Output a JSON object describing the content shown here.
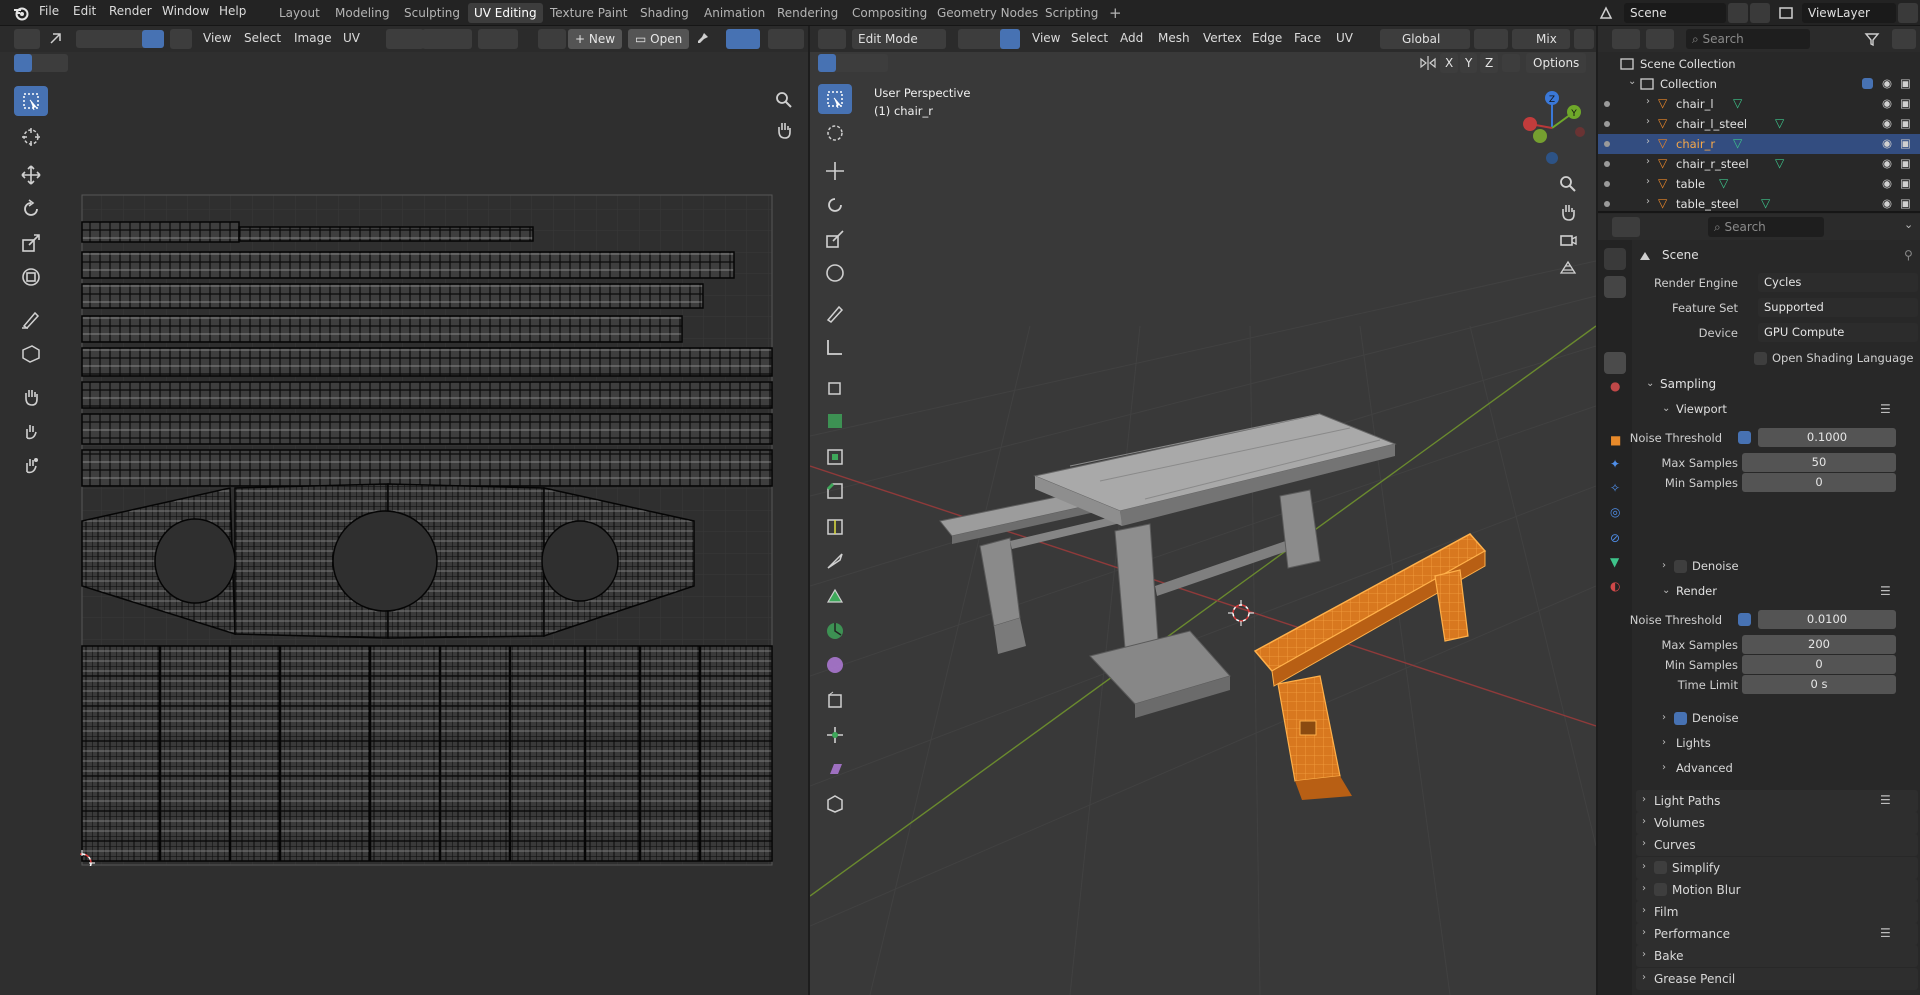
{
  "menu": {
    "items": [
      "File",
      "Edit",
      "Render",
      "Window",
      "Help"
    ],
    "workspaces": [
      "Layout",
      "Modeling",
      "Sculpting",
      "UV Editing",
      "Texture Paint",
      "Shading",
      "Animation",
      "Rendering",
      "Compositing",
      "Geometry Nodes",
      "Scripting"
    ],
    "active_workspace": "UV Editing",
    "add_workspace": "+",
    "scene_name": "Scene",
    "view_layer": "ViewLayer",
    "search_placeholder": "Search"
  },
  "uv_editor": {
    "menus": [
      "View",
      "Select",
      "Image",
      "UV"
    ],
    "new_label": "New",
    "open_label": "Open"
  },
  "viewport": {
    "mode": "Edit Mode",
    "menus": [
      "View",
      "Select",
      "Add",
      "Mesh",
      "Vertex",
      "Edge",
      "Face",
      "UV"
    ],
    "orientation": "Global",
    "mix_label": "Mix",
    "options_label": "Options",
    "axes": [
      "X",
      "Y",
      "Z"
    ],
    "overlay_line1": "User Perspective",
    "overlay_line2": "(1) chair_r"
  },
  "outliner": {
    "root": "Scene Collection",
    "collection": "Collection",
    "search_placeholder": "Search",
    "objects": [
      {
        "name": "chair_l",
        "selected": false
      },
      {
        "name": "chair_l_steel",
        "selected": false
      },
      {
        "name": "chair_r",
        "selected": true
      },
      {
        "name": "chair_r_steel",
        "selected": false
      },
      {
        "name": "table",
        "selected": false
      },
      {
        "name": "table_steel",
        "selected": false
      }
    ]
  },
  "properties": {
    "search_placeholder": "Search",
    "context": "Scene",
    "render_engine_label": "Render Engine",
    "render_engine": "Cycles",
    "feature_set_label": "Feature Set",
    "feature_set": "Supported",
    "device_label": "Device",
    "device": "GPU Compute",
    "osl_label": "Open Shading Language",
    "sampling": "Sampling",
    "viewport": "Viewport",
    "noise_threshold_label": "Noise Threshold",
    "viewport_noise_threshold": "0.1000",
    "max_samples_label": "Max Samples",
    "viewport_max_samples": "50",
    "min_samples_label": "Min Samples",
    "viewport_min_samples": "0",
    "denoise_label": "Denoise",
    "render": "Render",
    "render_noise_threshold": "0.0100",
    "render_max_samples": "200",
    "render_min_samples": "0",
    "time_limit_label": "Time Limit",
    "time_limit": "0 s",
    "lights": "Lights",
    "advanced": "Advanced",
    "sections": [
      "Light Paths",
      "Volumes",
      "Curves",
      "Simplify",
      "Motion Blur",
      "Film",
      "Performance",
      "Bake",
      "Grease Pencil"
    ]
  },
  "colors": {
    "accent": "#4772b3",
    "selection_orange": "#f18c1e",
    "object_orange": "#e8862a",
    "mesh_green": "#3ec48b"
  }
}
